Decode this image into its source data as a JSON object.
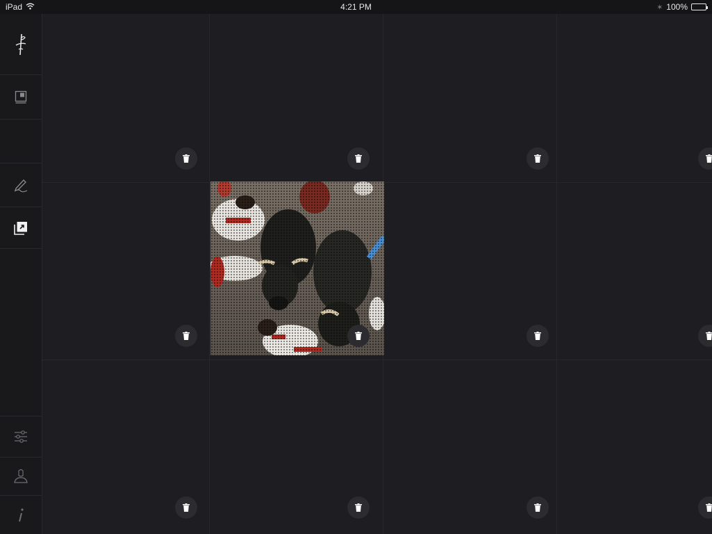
{
  "status_bar": {
    "device": "iPad",
    "time": "4:21 PM",
    "battery": "100%"
  },
  "sidebar": {
    "items": [
      {
        "icon": "pen-nib-logo-icon"
      },
      {
        "icon": "notebook-icon"
      },
      {
        "icon": "blank"
      },
      {
        "icon": "pencil-sign-icon"
      },
      {
        "icon": "layers-export-icon"
      },
      {
        "icon": "sliders-icon"
      },
      {
        "icon": "user-icon"
      },
      {
        "icon": "info-icon"
      }
    ]
  },
  "grid": {
    "columns": 4,
    "rows": 3,
    "filled_cell": {
      "row": 1,
      "col": 1,
      "content": "photo"
    }
  },
  "colors": {
    "background": "#1e1e22",
    "sidebar": "#19191c",
    "status_bar": "#151517",
    "trash_button": "#2b2b30"
  }
}
